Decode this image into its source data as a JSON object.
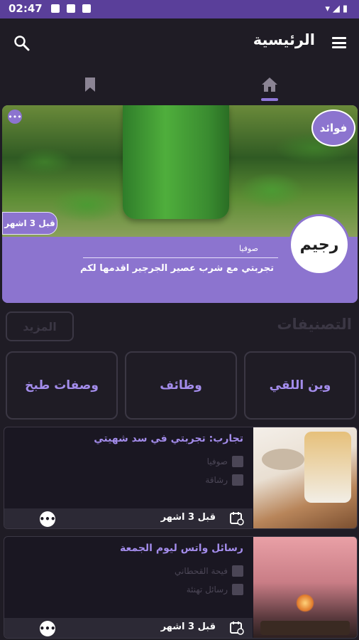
{
  "status_bar": {
    "time": "02:47",
    "right_icons": "▾◢▮"
  },
  "app_bar": {
    "title": "الرئيسية"
  },
  "featured": {
    "category_badge": "فوائد",
    "time": "قبل 3 اشهر",
    "author": "صوفيا",
    "title": "تجربتي مع شرب عصير الجرجير اقدمها لكم",
    "logo_text": "رجيم"
  },
  "categories": {
    "heading": "التصنيفات",
    "more_label": "المزيد",
    "items": [
      "وين اللقي",
      "وظائف",
      "وصفات طبخ"
    ]
  },
  "articles": [
    {
      "title": "تجارب: تجربتي في سد شهيتي",
      "author": "صوفيا",
      "tag": "رشاقة",
      "date": "قبل 3 اشهر"
    },
    {
      "title": "رسائل واتس ليوم الجمعة",
      "author": "فيحة القحطاني",
      "tag": "رسائل تهنئة",
      "date": "قبل 3 اشهر"
    }
  ],
  "colors": {
    "accent": "#8c74cf",
    "status_bar": "#5a3f9a",
    "background": "#1f1c25"
  }
}
